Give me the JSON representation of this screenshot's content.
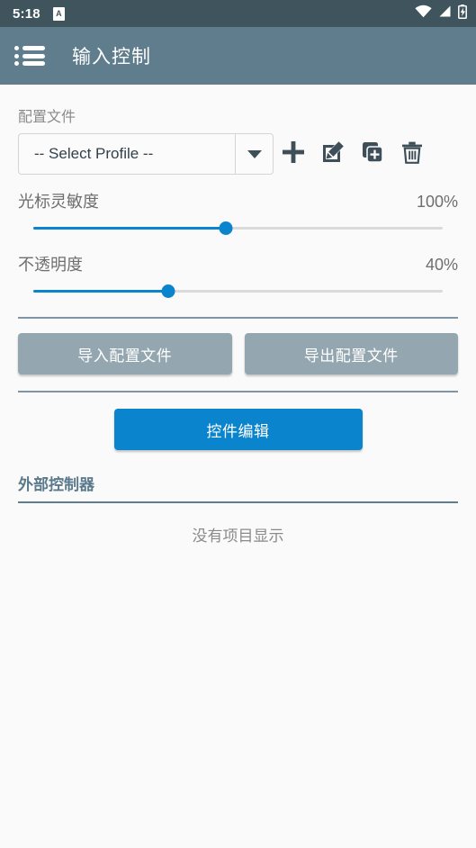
{
  "status_bar": {
    "time": "5:18",
    "notification_icon_glyph": "A",
    "icons": [
      "wifi-icon",
      "cellular-signal-icon",
      "battery-charging-icon"
    ]
  },
  "app_bar": {
    "menu_icon": "list-menu-icon",
    "title": "输入控制"
  },
  "profile": {
    "label": "配置文件",
    "select_value": "-- Select Profile --",
    "actions": [
      {
        "name": "add-profile-button",
        "icon": "plus-icon"
      },
      {
        "name": "edit-profile-button",
        "icon": "edit-pencil-icon"
      },
      {
        "name": "duplicate-profile-button",
        "icon": "duplicate-icon"
      },
      {
        "name": "delete-profile-button",
        "icon": "trash-icon"
      }
    ]
  },
  "sliders": [
    {
      "name": "光标灵敏度",
      "value_label": "100%",
      "percent": 47
    },
    {
      "name": "不透明度",
      "value_label": "40%",
      "percent": 33
    }
  ],
  "buttons": {
    "import_profile": "导入配置文件",
    "export_profile": "导出配置文件",
    "widget_edit": "控件编辑"
  },
  "external_controller": {
    "title": "外部控制器",
    "empty_message": "没有项目显示"
  },
  "colors": {
    "status_bar": "#40545E",
    "app_bar": "#5F7D8C",
    "accent_blue": "#0B84CE",
    "grey_button": "#94A7B1",
    "divider": "#7F95A6",
    "background": "#FAFAFA",
    "icon_dark": "#3E4F59"
  }
}
